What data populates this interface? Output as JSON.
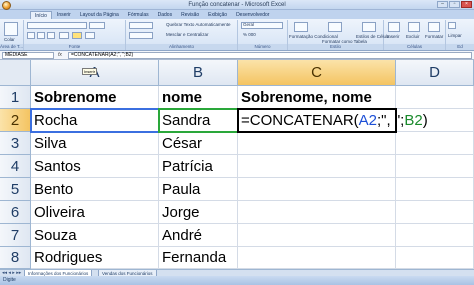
{
  "window": {
    "title": "Função concatenar - Microsoft Excel"
  },
  "ribbon": {
    "tabs": [
      "Início",
      "Inserir",
      "Layout da Página",
      "Fórmulas",
      "Dados",
      "Revisão",
      "Exibição",
      "Desenvolvedor"
    ],
    "active_tab": "Início",
    "groups": [
      {
        "label": "Área de T..."
      },
      {
        "label": "Fonte"
      },
      {
        "label": "Alinhamento"
      },
      {
        "label": "Número"
      },
      {
        "label": "Estilo"
      },
      {
        "label": "Células"
      },
      {
        "label": "Ed"
      }
    ],
    "wrap_text": "Quebrar Texto Automaticamente",
    "merge_center": "Mesclar e Centralizar",
    "number_format": "Geral",
    "percent": "% 000",
    "cond_format": "Formatação Condicional",
    "format_table": "Formatar como Tabela",
    "cell_styles": "Estilos de Célula",
    "insert": "Inserir",
    "delete": "Excluir",
    "format": "Formatar",
    "clear": "Limpar",
    "paste_label": "Colar"
  },
  "formula_bar": {
    "name_box": "MÉDIASE",
    "fx": "fx",
    "formula": "=CONCATENAR(A2;\", \";B2)"
  },
  "grid": {
    "columns": [
      "A",
      "B",
      "C",
      "D"
    ],
    "rows": [
      "1",
      "2",
      "3",
      "4",
      "5",
      "6",
      "7",
      "8"
    ],
    "tooltip": "Inserir",
    "header_row": [
      "Sobrenome",
      "nome",
      "Sobrenome, nome"
    ],
    "data": [
      [
        "Rocha",
        "Sandra"
      ],
      [
        "Silva",
        "César"
      ],
      [
        "Santos",
        "Patrícia"
      ],
      [
        "Bento",
        "Paula"
      ],
      [
        "Oliveira",
        "Jorge"
      ],
      [
        "Souza",
        "André"
      ],
      [
        "Rodrigues",
        "Fernanda"
      ]
    ],
    "edit_formula": {
      "prefix": "=CONCATENAR(",
      "ref_a": "A2",
      "middle": ";\", \";",
      "ref_b": "B2",
      "suffix": ")"
    }
  },
  "sheets": {
    "tabs": [
      "Informações dos Funcionários",
      "Vendas dos Funcionários"
    ],
    "active": "Informações dos Funcionários"
  },
  "status": {
    "mode": "Digite"
  },
  "colors": {
    "ref_a": "#1c4fd6",
    "ref_b": "#1a8a2c",
    "selected_header": "#f4c462"
  }
}
